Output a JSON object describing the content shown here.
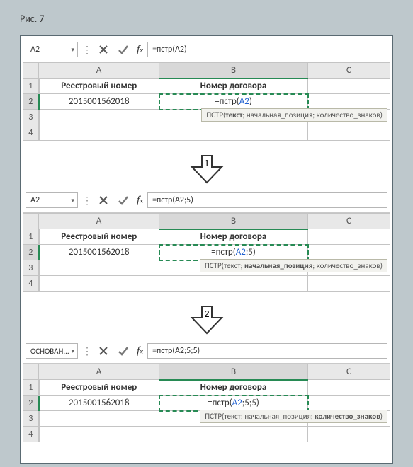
{
  "caption": "Рис. 7",
  "columns": {
    "A": "A",
    "B": "B",
    "C": "C"
  },
  "rowLabels": [
    "1",
    "2",
    "3",
    "4"
  ],
  "headers": {
    "colA": "Реестровый номер",
    "colB": "Номер договора"
  },
  "dataA2": "2015001562018",
  "step1": {
    "namebox": "A2",
    "formula": "=пстр(A2)",
    "cellPrefix": "=пстр(",
    "cellRef": "A2",
    "cellSuffix": ")",
    "tooltipPrefix": "ПСТР(",
    "tooltipP1": "текст",
    "tooltipRest": "; начальная_позиция; количество_знаков)"
  },
  "step2": {
    "namebox": "A2",
    "formula": "=пстр(A2;5)",
    "cellPrefix": "=пстр(",
    "cellRef": "A2",
    "cellMid": ";",
    "cellNum": "5",
    "cellSuffix": ")",
    "tooltipPrefix": "ПСТР(текст; ",
    "tooltipP2": "начальная_позиция",
    "tooltipRest": "; количество_знаков)"
  },
  "step3": {
    "namebox": "ОСНОВАН...",
    "formula": "=пстр(A2;5;5)",
    "cellPrefix": "=пстр(",
    "cellRef": "A2",
    "cellMid": ";5;",
    "cellNum": "5",
    "cellSuffix": ")",
    "tooltipPrefix": "ПСТР(текст; начальная_позиция; ",
    "tooltipP3": "количество_знаков",
    "tooltipRest": ")"
  },
  "arrows": {
    "first": "1",
    "second": "2"
  },
  "icons": {
    "dropdown": "▾",
    "cancel": "✕",
    "accept": "✓",
    "fx": "fx"
  }
}
